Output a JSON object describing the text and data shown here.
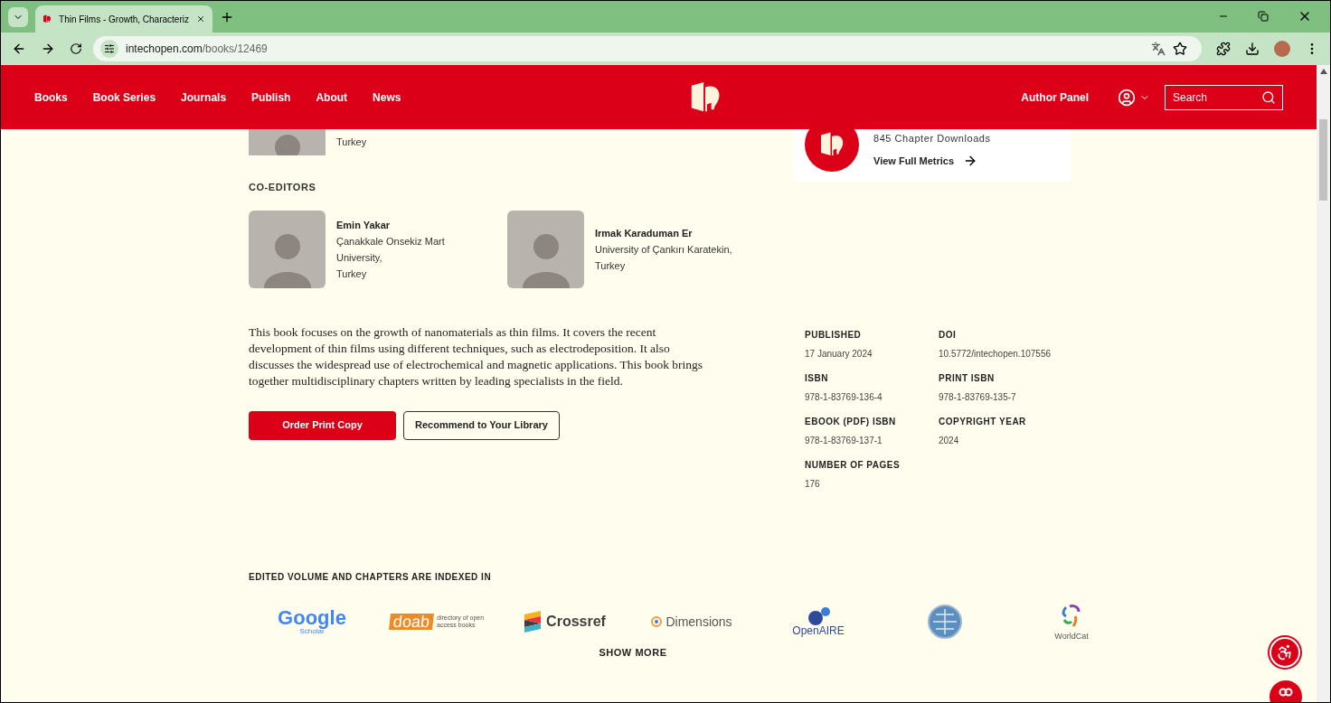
{
  "browser": {
    "tab": {
      "title": "Thin Films - Growth, Characteriz",
      "selected": true
    },
    "url_host": "intechopen.com",
    "url_path": "/books/12469"
  },
  "nav": {
    "links": [
      "Books",
      "Book Series",
      "Journals",
      "Publish",
      "About",
      "News"
    ],
    "author_panel": "Author Panel",
    "search": {
      "placeholder": "Search"
    }
  },
  "editor_partial": {
    "country": "Turkey"
  },
  "metrics": {
    "downloads": "845 Chapter Downloads",
    "link": "View Full Metrics"
  },
  "coeditors": {
    "heading": "CO-EDITORS",
    "people": [
      {
        "name": "Emin Yakar",
        "affiliation": [
          "Çanakkale Onsekiz Mart",
          "University,",
          "Turkey"
        ]
      },
      {
        "name": "Irmak Karaduman Er",
        "affiliation": [
          "University of Çankırı Karatekin,",
          "Turkey"
        ]
      }
    ]
  },
  "description": "This book focuses on the growth of nanomaterials as thin films. It covers the recent development of thin films using different techniques, such as electrodeposition. It also discusses the widespread use of electrochemical and magnetic applications. This book brings together multidisciplinary chapters written by leading specialists in the field.",
  "buttons": [
    {
      "label": "Order Print Copy",
      "kind": "primary"
    },
    {
      "label": "Recommend to Your Library",
      "kind": "outline"
    }
  ],
  "details": [
    {
      "label": "PUBLISHED",
      "value": "17 January 2024"
    },
    {
      "label": "DOI",
      "value": "10.5772/intechopen.107556"
    },
    {
      "label": "ISBN",
      "value": "978-1-83769-136-4"
    },
    {
      "label": "PRINT ISBN",
      "value": "978-1-83769-135-7"
    },
    {
      "label": "EBOOK (PDF) ISBN",
      "value": "978-1-83769-137-1"
    },
    {
      "label": "COPYRIGHT YEAR",
      "value": "2024"
    },
    {
      "label": "NUMBER OF PAGES",
      "value": "176"
    }
  ],
  "indexed": {
    "heading": "EDITED VOLUME AND CHAPTERS ARE INDEXED IN",
    "logos": [
      {
        "kind": "google",
        "text": "Google",
        "sub": "Scholar"
      },
      {
        "kind": "doab",
        "text": "doab",
        "sub": "directory of open access books"
      },
      {
        "kind": "crossref",
        "text": "Crossref"
      },
      {
        "kind": "dimensions",
        "text": "Dimensions"
      },
      {
        "kind": "openaire",
        "text": "OpenAIRE"
      },
      {
        "kind": "ebsco"
      },
      {
        "kind": "worldcat",
        "text": "WorldCat"
      }
    ],
    "show_more": "SHOW MORE"
  }
}
